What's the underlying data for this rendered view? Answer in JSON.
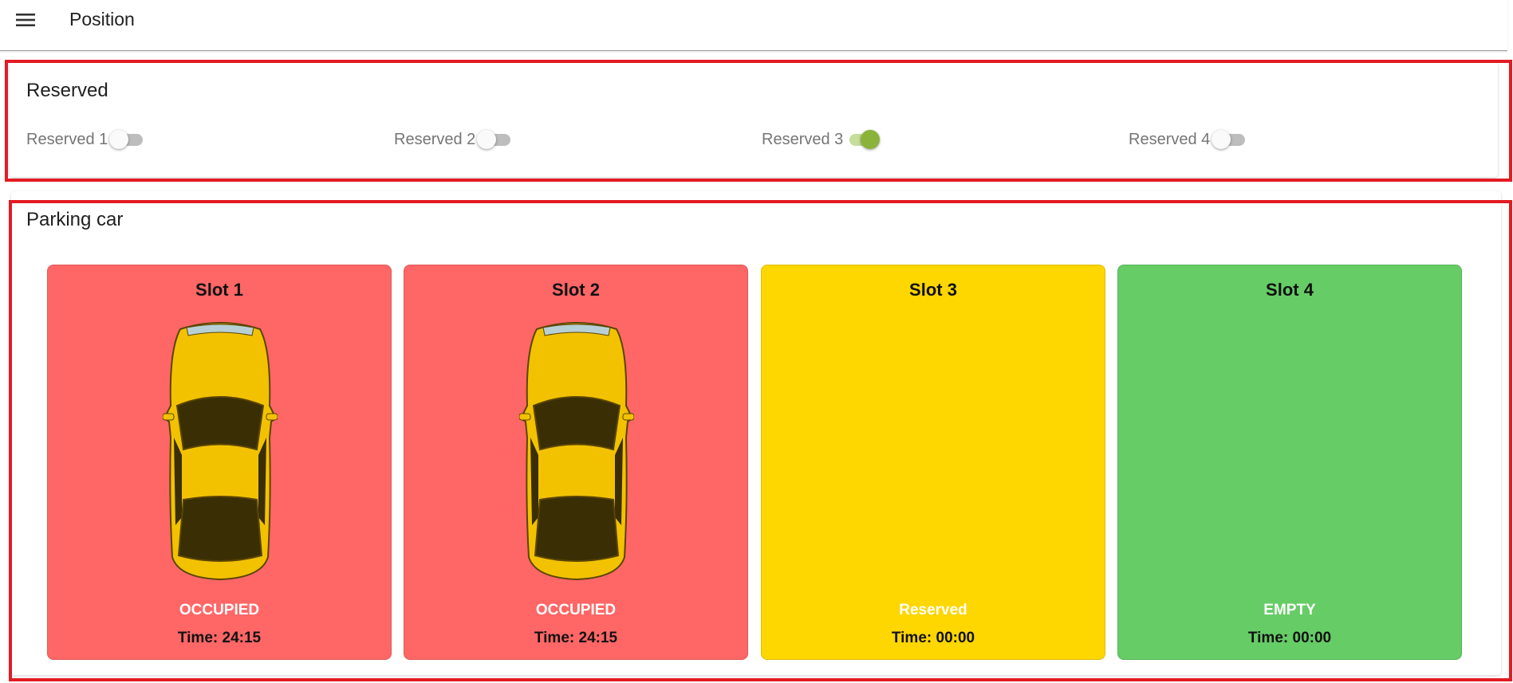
{
  "appbar": {
    "menu_icon": "hamburger-menu-icon",
    "title": "Position"
  },
  "reserved": {
    "title": "Reserved",
    "switches": [
      {
        "label": "Reserved 1",
        "on": false
      },
      {
        "label": "Reserved 2",
        "on": false
      },
      {
        "label": "Reserved 3",
        "on": true
      },
      {
        "label": "Reserved 4",
        "on": false
      }
    ]
  },
  "parking": {
    "title": "Parking car",
    "slots": [
      {
        "title": "Slot 1",
        "status": "OCCUPIED",
        "time": "Time: 24:15",
        "color": "#ff6666",
        "has_car": true
      },
      {
        "title": "Slot 2",
        "status": "OCCUPIED",
        "time": "Time: 24:15",
        "color": "#ff6666",
        "has_car": true
      },
      {
        "title": "Slot 3",
        "status": "Reserved",
        "time": "Time: 00:00",
        "color": "#fed600",
        "has_car": false
      },
      {
        "title": "Slot 4",
        "status": "EMPTY",
        "time": "Time: 00:00",
        "color": "#66cc66",
        "has_car": false
      }
    ]
  },
  "colors": {
    "highlight": "#e31b23",
    "switch_on": "#8bb33a",
    "car_body": "#f2c200",
    "car_glass": "#3a2e05"
  }
}
